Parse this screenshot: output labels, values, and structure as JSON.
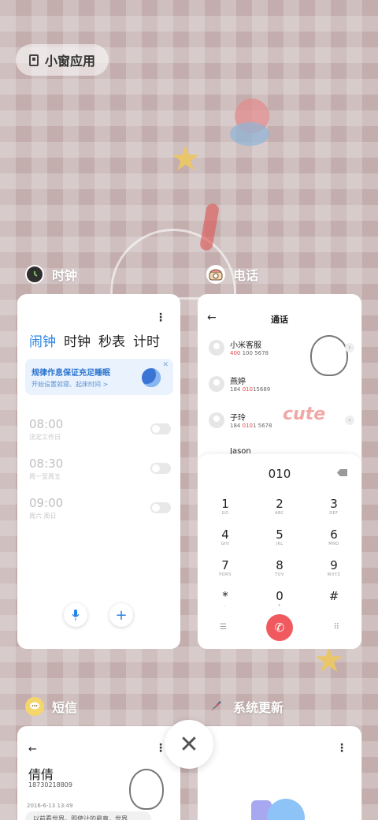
{
  "small_window": {
    "label": "小窗应用"
  },
  "apps": {
    "clock": {
      "name": "时钟",
      "tabs": [
        "闹钟",
        "时钟",
        "秒表",
        "计时"
      ],
      "banner": {
        "title": "规律作息保证充足睡眠",
        "subtitle": "开始设置就寝、起床时间 >"
      },
      "alarms": [
        {
          "time": "08:00",
          "days": "法定工作日"
        },
        {
          "time": "08:30",
          "days": "周一至周五"
        },
        {
          "time": "09:00",
          "days": "周六 周日"
        }
      ]
    },
    "phone": {
      "name": "电话",
      "title": "通话",
      "contacts": [
        {
          "name": "小米客服",
          "number_hl": "400",
          "number_rest": " 100 5678"
        },
        {
          "name": "燕婷",
          "number_pre": "184 ",
          "number_hl": "010",
          "number_rest": "15689"
        },
        {
          "name": "子玲",
          "number_pre": "184 ",
          "number_hl": "010",
          "number_rest": "1 5678"
        },
        {
          "name": "Jason"
        }
      ],
      "dial_input": "010",
      "keys": [
        {
          "k": "1",
          "s": "GO"
        },
        {
          "k": "2",
          "s": "ABC"
        },
        {
          "k": "3",
          "s": "DEF"
        },
        {
          "k": "4",
          "s": "GHI"
        },
        {
          "k": "5",
          "s": "JKL"
        },
        {
          "k": "6",
          "s": "MNO"
        },
        {
          "k": "7",
          "s": "PQRS"
        },
        {
          "k": "8",
          "s": "TUV"
        },
        {
          "k": "9",
          "s": "WXYZ"
        },
        {
          "k": "*",
          "s": ","
        },
        {
          "k": "0",
          "s": "+"
        },
        {
          "k": "#",
          "s": ""
        }
      ]
    },
    "sms": {
      "name": "短信",
      "contact_name": "倩倩",
      "contact_number": "18730218809",
      "date": "2016-6-13 13:49",
      "preview": "以前看世界，即使计的最直，世界"
    },
    "update": {
      "name": "系统更新"
    }
  },
  "colors": {
    "accent": "#2a83e6",
    "call_red": "#f05a5f"
  }
}
